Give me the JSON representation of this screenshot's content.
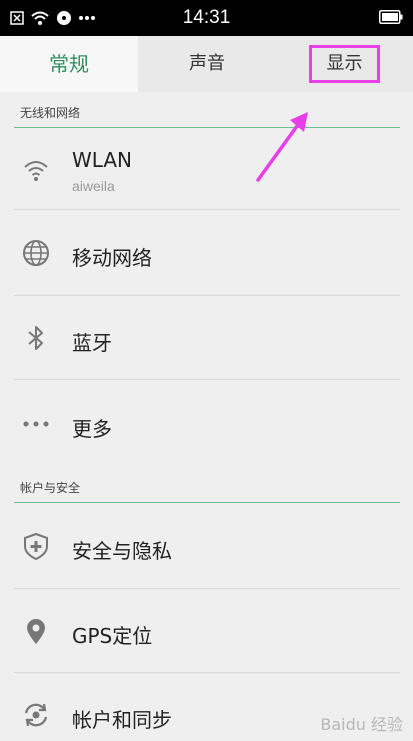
{
  "status_bar": {
    "time": "14:31"
  },
  "tabs": [
    {
      "label": "常规"
    },
    {
      "label": "声音"
    },
    {
      "label": "显示"
    }
  ],
  "sections": [
    {
      "header": "无线和网络"
    },
    {
      "header": "帐户与安全"
    }
  ],
  "items": [
    {
      "title": "WLAN",
      "subtitle": "aiweila",
      "icon": "wifi-icon"
    },
    {
      "title": "移动网络",
      "icon": "globe-icon"
    },
    {
      "title": "蓝牙",
      "icon": "bluetooth-icon"
    },
    {
      "title": "更多",
      "icon": "more-dots-icon"
    },
    {
      "title": "安全与隐私",
      "icon": "shield-plus-icon"
    },
    {
      "title": "GPS定位",
      "icon": "location-pin-icon"
    },
    {
      "title": "帐户和同步",
      "icon": "sync-icon"
    }
  ],
  "colors": {
    "accent": "#2f8f5e",
    "highlight": "#e83ee9"
  },
  "watermark": "Baidu 经验"
}
